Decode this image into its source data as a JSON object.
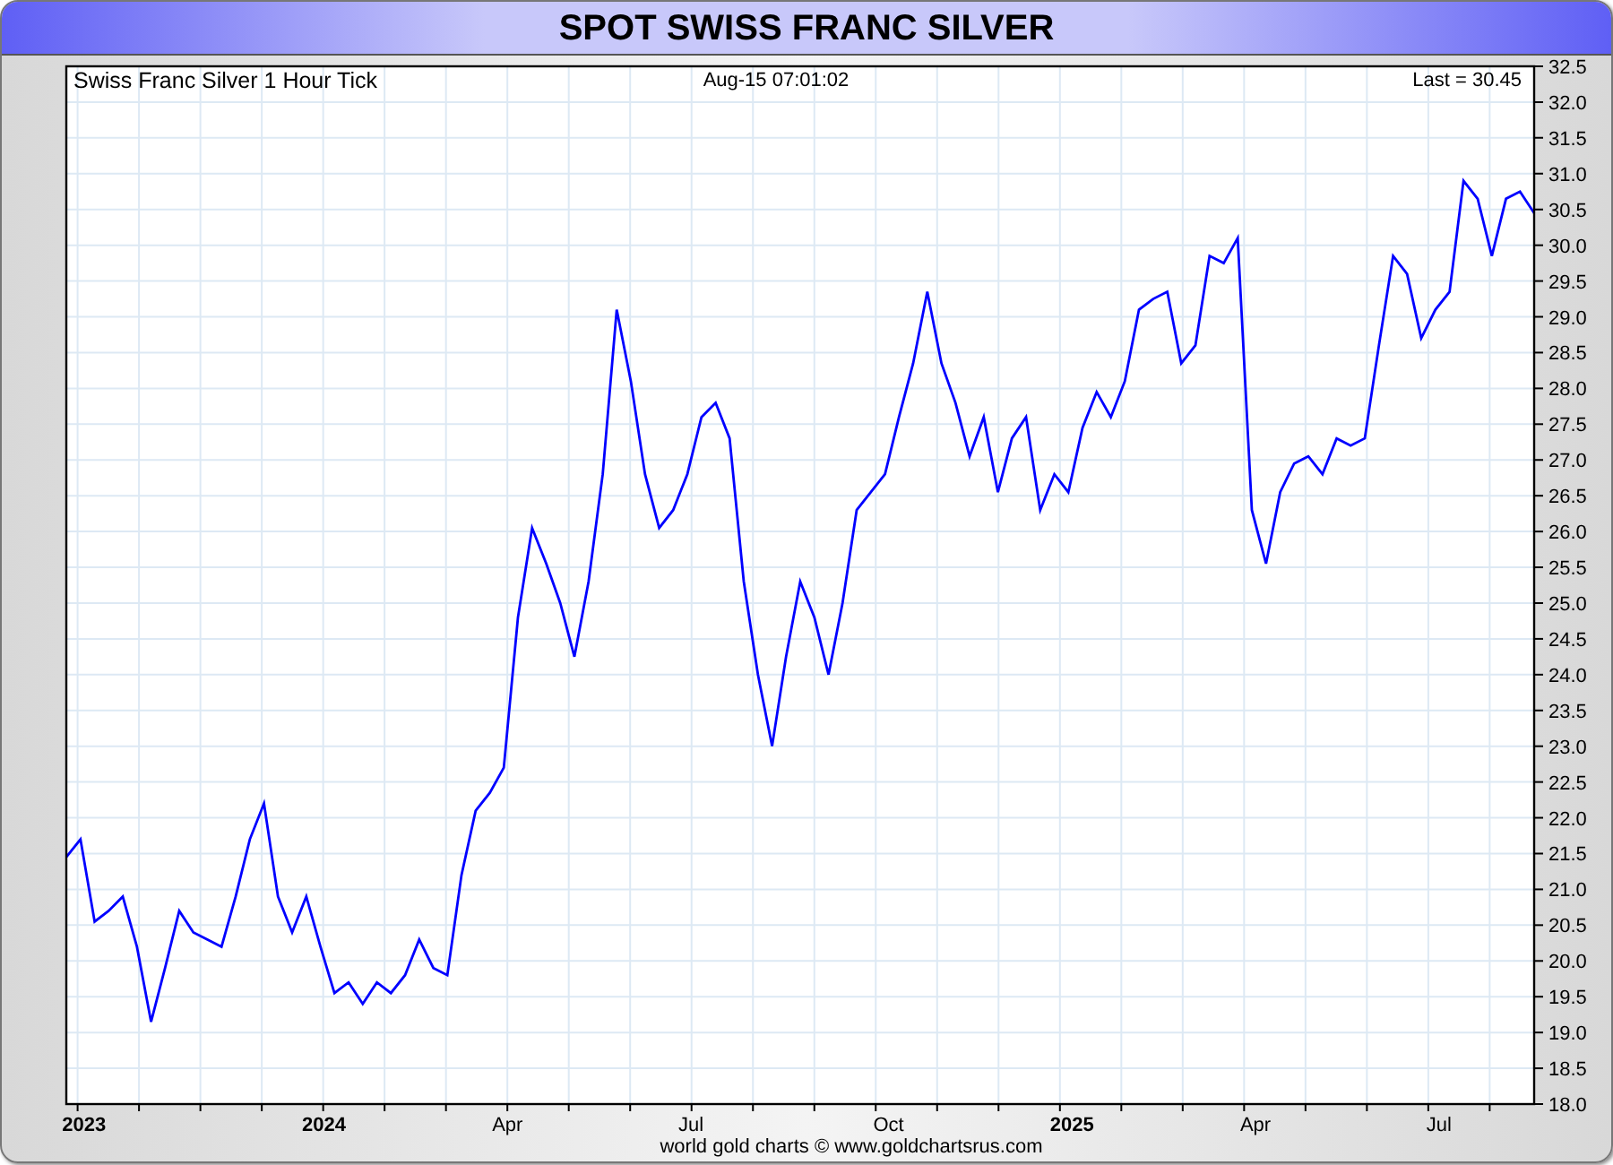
{
  "title": "SPOT SWISS FRANC SILVER",
  "chart": {
    "caption": "Swiss Franc Silver 1 Hour Tick",
    "timestamp": "Aug-15  07:01:02",
    "last": "Last = 30.45",
    "footer": "world gold charts © www.goldchartsrus.com",
    "chart_data": {
      "type": "line",
      "categories": [
        null,
        "2023",
        null,
        null,
        null,
        null,
        null,
        null,
        null,
        null,
        null,
        null,
        null,
        null,
        null,
        null,
        null,
        null,
        "2024",
        null,
        null,
        null,
        null,
        null,
        null,
        null,
        null,
        null,
        null,
        null,
        null,
        "Apr",
        null,
        null,
        null,
        null,
        null,
        null,
        null,
        null,
        null,
        null,
        null,
        null,
        "Jul",
        null,
        null,
        null,
        null,
        null,
        null,
        null,
        null,
        null,
        null,
        null,
        null,
        null,
        "Oct",
        null,
        null,
        null,
        null,
        null,
        null,
        null,
        null,
        null,
        null,
        null,
        null,
        "2025",
        null,
        null,
        null,
        null,
        null,
        null,
        null,
        null,
        null,
        null,
        null,
        null,
        "Apr",
        null,
        null,
        null,
        null,
        null,
        null,
        null,
        null,
        null,
        null,
        null,
        null,
        "Jul",
        null,
        null,
        null,
        null,
        null,
        null,
        null
      ],
      "series": [
        {
          "color": "#0000ff",
          "values": [
            21.45,
            21.7,
            20.55,
            20.7,
            20.9,
            20.2,
            19.15,
            19.9,
            20.7,
            20.4,
            20.3,
            20.2,
            20.9,
            21.7,
            22.2,
            20.9,
            20.4,
            20.9,
            20.2,
            19.55,
            19.7,
            19.4,
            19.7,
            19.55,
            19.8,
            20.3,
            19.9,
            19.8,
            21.2,
            22.1,
            22.35,
            22.7,
            24.8,
            26.05,
            25.55,
            25.0,
            24.25,
            25.3,
            26.8,
            29.1,
            28.1,
            26.8,
            26.05,
            26.3,
            26.8,
            27.6,
            27.8,
            27.3,
            25.3,
            24.0,
            23.0,
            24.25,
            25.3,
            24.8,
            24.0,
            25.0,
            26.3,
            26.55,
            26.8,
            27.6,
            28.35,
            29.35,
            28.35,
            27.8,
            27.05,
            27.6,
            26.55,
            27.3,
            27.6,
            26.3,
            26.8,
            26.55,
            27.45,
            27.95,
            27.6,
            28.1,
            29.1,
            29.25,
            29.35,
            28.35,
            28.6,
            29.85,
            29.75,
            30.1,
            26.3,
            25.55,
            26.55,
            26.95,
            27.05,
            26.8,
            27.3,
            27.2,
            27.3,
            28.6,
            29.85,
            29.6,
            28.7,
            29.1,
            29.35,
            30.9,
            30.65,
            29.85,
            30.65,
            30.75,
            30.45
          ]
        }
      ],
      "ylim": [
        18.0,
        32.5
      ],
      "grid": true,
      "yticks": [
        {
          "value": 18,
          "label": "18.0"
        },
        {
          "value": 18.5,
          "label": "18.5"
        },
        {
          "value": 19,
          "label": "19.0"
        },
        {
          "value": 19.5,
          "label": "19.5"
        },
        {
          "value": 20,
          "label": "20.0"
        },
        {
          "value": 20.5,
          "label": "20.5"
        },
        {
          "value": 21,
          "label": "21.0"
        },
        {
          "value": 21.5,
          "label": "21.5"
        },
        {
          "value": 22,
          "label": "22.0"
        },
        {
          "value": 22.5,
          "label": "22.5"
        },
        {
          "value": 23,
          "label": "23.0"
        },
        {
          "value": 23.5,
          "label": "23.5"
        },
        {
          "value": 24,
          "label": "24.0"
        },
        {
          "value": 24.5,
          "label": "24.5"
        },
        {
          "value": 25,
          "label": "25.0"
        },
        {
          "value": 25.5,
          "label": "25.5"
        },
        {
          "value": 26,
          "label": "26.0"
        },
        {
          "value": 26.5,
          "label": "26.5"
        },
        {
          "value": 27,
          "label": "27.0"
        },
        {
          "value": 27.5,
          "label": "27.5"
        },
        {
          "value": 28,
          "label": "28.0"
        },
        {
          "value": 28.5,
          "label": "28.5"
        },
        {
          "value": 29,
          "label": "29.0"
        },
        {
          "value": 29.5,
          "label": "29.5"
        },
        {
          "value": 30,
          "label": "30.0"
        },
        {
          "value": 30.5,
          "label": "30.5"
        },
        {
          "value": 31,
          "label": "31.0"
        },
        {
          "value": 31.5,
          "label": "31.5"
        },
        {
          "value": 32,
          "label": "32.0"
        },
        {
          "value": 32.5,
          "label": "32.5"
        }
      ]
    }
  }
}
